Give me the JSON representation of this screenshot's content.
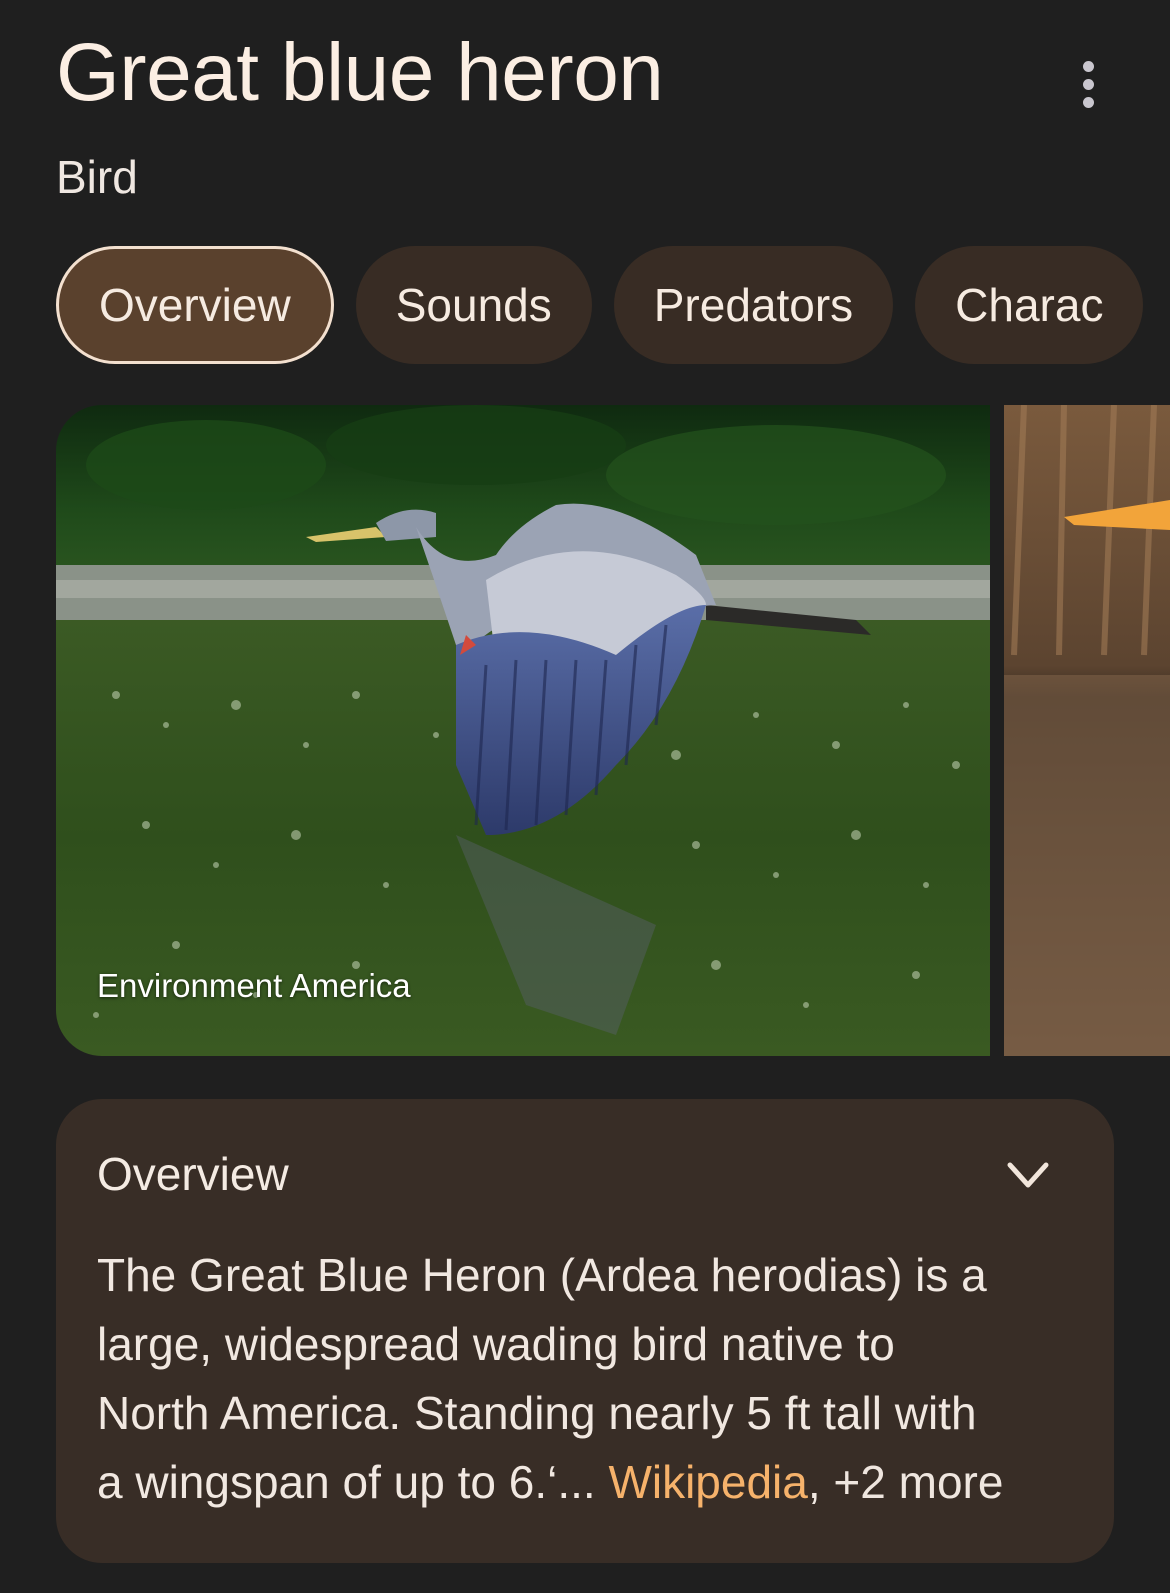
{
  "header": {
    "title": "Great blue heron",
    "subtitle": "Bird",
    "more_icon": "more-vert-icon"
  },
  "tabs": [
    {
      "label": "Overview",
      "active": true
    },
    {
      "label": "Sounds",
      "active": false
    },
    {
      "label": "Predators",
      "active": false
    },
    {
      "label": "Charac",
      "active": false
    }
  ],
  "gallery": {
    "main_caption": "Environment America"
  },
  "overview": {
    "heading": "Overview",
    "toggle_icon": "chevron-down-icon",
    "lines": [
      "The Great Blue Heron (Ardea herodias) is a",
      "large, widespread wading bird native to",
      "North America. Standing nearly 5 ft tall with",
      "a wingspan of up to 6.‘... "
    ],
    "source_link": "Wikipedia",
    "separator": ", ",
    "more_link": "+2 more"
  },
  "colors": {
    "background": "#1f1f1f",
    "chip": "#382c24",
    "chip_active": "#5a412d",
    "card": "#382d26",
    "link": "#f6b26b"
  }
}
